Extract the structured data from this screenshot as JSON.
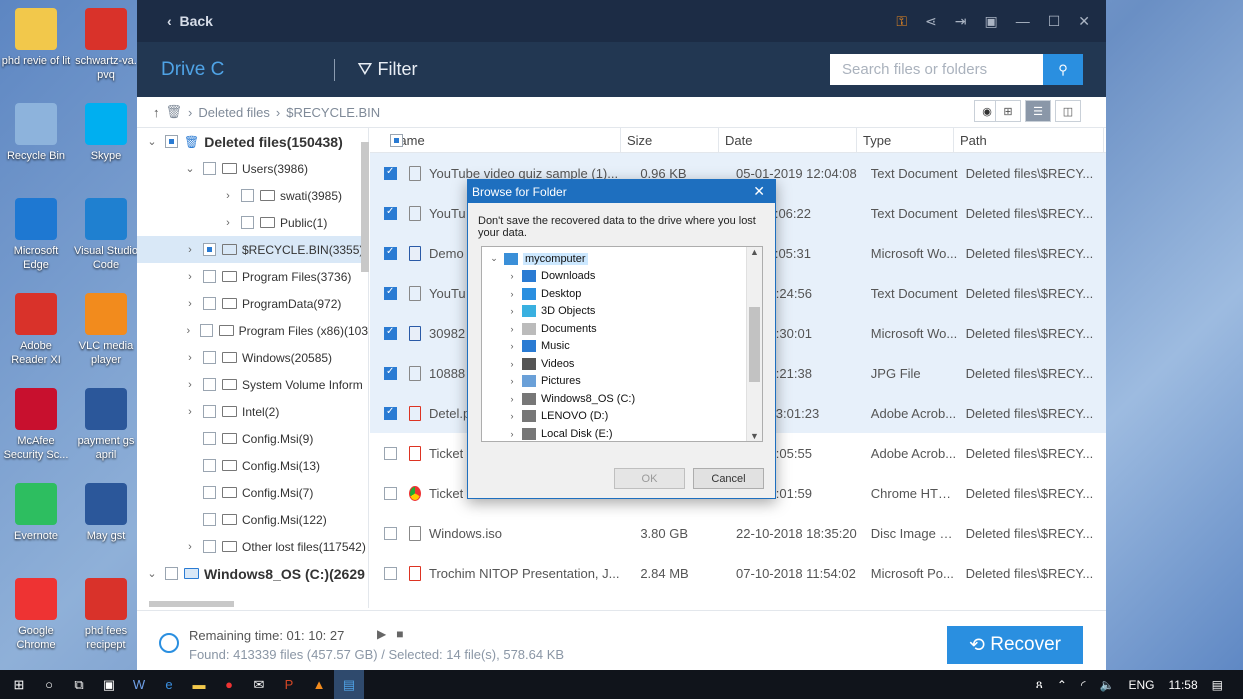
{
  "desktop_icons": [
    {
      "label": "phd revie of lit",
      "icon": "document-icon",
      "color": "#f2c84b"
    },
    {
      "label": "schwartz-va. pvq",
      "icon": "pdf-icon",
      "color": "#d9322a"
    },
    {
      "label": "Recycle Bin",
      "icon": "recycle-bin-icon",
      "color": "#8db3dc"
    },
    {
      "label": "Skype",
      "icon": "skype-icon",
      "color": "#00aff0"
    },
    {
      "label": "Microsoft Edge",
      "icon": "edge-icon",
      "color": "#1e78d2"
    },
    {
      "label": "Visual Studio Code",
      "icon": "vscode-icon",
      "color": "#1f80d0"
    },
    {
      "label": "Adobe Reader XI",
      "icon": "adobe-reader-icon",
      "color": "#d9322a"
    },
    {
      "label": "VLC media player",
      "icon": "vlc-icon",
      "color": "#f28b1d"
    },
    {
      "label": "McAfee Security Sc...",
      "icon": "mcafee-icon",
      "color": "#c8102e"
    },
    {
      "label": "payment gs april",
      "icon": "word-doc-icon",
      "color": "#2b579a"
    },
    {
      "label": "Evernote",
      "icon": "evernote-icon",
      "color": "#2dbe60"
    },
    {
      "label": "May gst",
      "icon": "word-doc-icon",
      "color": "#2b579a"
    },
    {
      "label": "Google Chrome",
      "icon": "chrome-icon",
      "color": "#e33"
    },
    {
      "label": "phd fees recipept",
      "icon": "pdf-icon",
      "color": "#d9322a"
    }
  ],
  "app": {
    "back_label": "Back",
    "drive_label": "Drive C",
    "filter_label": "Filter",
    "search_placeholder": "Search files or folders",
    "breadcrumb": [
      "Deleted files",
      "$RECYCLE.BIN"
    ],
    "tree": [
      {
        "label": "Deleted files(150438)",
        "indent": 0,
        "arrow": "⌄",
        "check": "part",
        "bold": true,
        "icon": "trash"
      },
      {
        "label": "Users(3986)",
        "indent": 1,
        "arrow": "⌄",
        "check": "none"
      },
      {
        "label": "swati(3985)",
        "indent": 2,
        "arrow": "›",
        "check": "none"
      },
      {
        "label": "Public(1)",
        "indent": 2,
        "arrow": "›",
        "check": "none"
      },
      {
        "label": "$RECYCLE.BIN(3355)",
        "indent": 1,
        "arrow": "›",
        "check": "part",
        "selected": true
      },
      {
        "label": "Program Files(3736)",
        "indent": 1,
        "arrow": "›",
        "check": "none"
      },
      {
        "label": "ProgramData(972)",
        "indent": 1,
        "arrow": "›",
        "check": "none"
      },
      {
        "label": "Program Files (x86)(103",
        "indent": 1,
        "arrow": "›",
        "check": "none"
      },
      {
        "label": "Windows(20585)",
        "indent": 1,
        "arrow": "›",
        "check": "none"
      },
      {
        "label": "System Volume Inform",
        "indent": 1,
        "arrow": "›",
        "check": "none"
      },
      {
        "label": "Intel(2)",
        "indent": 1,
        "arrow": "›",
        "check": "none"
      },
      {
        "label": "Config.Msi(9)",
        "indent": 1,
        "arrow": "",
        "check": "none"
      },
      {
        "label": "Config.Msi(13)",
        "indent": 1,
        "arrow": "",
        "check": "none"
      },
      {
        "label": "Config.Msi(7)",
        "indent": 1,
        "arrow": "",
        "check": "none"
      },
      {
        "label": "Config.Msi(122)",
        "indent": 1,
        "arrow": "",
        "check": "none"
      },
      {
        "label": "Other lost files(117542)",
        "indent": 1,
        "arrow": "›",
        "check": "none"
      },
      {
        "label": "Windows8_OS (C:)(2629",
        "indent": 0,
        "arrow": "⌄",
        "check": "none",
        "bold": true,
        "icon": "drive"
      }
    ],
    "columns": {
      "name": "Name",
      "size": "Size",
      "date": "Date",
      "type": "Type",
      "path": "Path"
    },
    "files": [
      {
        "name": "YouTube video quiz sample (1)...",
        "size": "0.96 KB",
        "date": "05-01-2019 12:04:08",
        "type": "Text Document",
        "path": "Deleted files\\$RECY...",
        "checked": true,
        "icon": "txt"
      },
      {
        "name": "YouTu",
        "size": "",
        "date": "019 11:06:22",
        "type": "Text Document",
        "path": "Deleted files\\$RECY...",
        "checked": true,
        "icon": "txt"
      },
      {
        "name": "Demo",
        "size": "",
        "date": "019 11:05:31",
        "type": "Microsoft Wo...",
        "path": "Deleted files\\$RECY...",
        "checked": true,
        "icon": "w"
      },
      {
        "name": "YouTu",
        "size": "",
        "date": "019 18:24:56",
        "type": "Text Document",
        "path": "Deleted files\\$RECY...",
        "checked": true,
        "icon": "txt"
      },
      {
        "name": "30982",
        "size": "",
        "date": "019 17:30:01",
        "type": "Microsoft Wo...",
        "path": "Deleted files\\$RECY...",
        "checked": true,
        "icon": "w"
      },
      {
        "name": "10888",
        "size": "",
        "date": "019 17:21:38",
        "type": "JPG File",
        "path": "Deleted files\\$RECY...",
        "checked": true,
        "icon": "img"
      },
      {
        "name": "Detel.p",
        "size": "",
        "date": "2018 13:01:23",
        "type": "Adobe Acrob...",
        "path": "Deleted files\\$RECY...",
        "checked": true,
        "icon": "pdf"
      },
      {
        "name": "Ticket",
        "size": "",
        "date": "018 12:05:55",
        "type": "Adobe Acrob...",
        "path": "Deleted files\\$RECY...",
        "checked": false,
        "icon": "pdf"
      },
      {
        "name": "Ticket",
        "size": "",
        "date": "018 12:01:59",
        "type": "Chrome HTM...",
        "path": "Deleted files\\$RECY...",
        "checked": false,
        "icon": "c"
      },
      {
        "name": "Windows.iso",
        "size": "3.80 GB",
        "date": "22-10-2018 18:35:20",
        "type": "Disc Image File",
        "path": "Deleted files\\$RECY...",
        "checked": false,
        "icon": "txt"
      },
      {
        "name": "Trochim NITOP Presentation, J...",
        "size": "2.84 MB",
        "date": "07-10-2018 11:54:02",
        "type": "Microsoft Po...",
        "path": "Deleted files\\$RECY...",
        "checked": false,
        "icon": "pdf"
      }
    ],
    "remaining_time": "Remaining time: 01: 10: 27",
    "found": "Found: 413339 files (457.57 GB) / Selected: 14 file(s), 578.64 KB",
    "recover_label": "Recover"
  },
  "dialog": {
    "title": "Browse for Folder",
    "message": "Don't save the recovered data to the drive where you lost your data.",
    "items": [
      {
        "label": "mycomputer",
        "arrow": "⌄",
        "indent": 0,
        "selected": true,
        "color": "#3a8fd8"
      },
      {
        "label": "Downloads",
        "arrow": "›",
        "indent": 1,
        "color": "#2a7bd3"
      },
      {
        "label": "Desktop",
        "arrow": "›",
        "indent": 1,
        "color": "#2a8fe0"
      },
      {
        "label": "3D Objects",
        "arrow": "›",
        "indent": 1,
        "color": "#39b0e0"
      },
      {
        "label": "Documents",
        "arrow": "›",
        "indent": 1,
        "color": "#bbb"
      },
      {
        "label": "Music",
        "arrow": "›",
        "indent": 1,
        "color": "#2a7bd3"
      },
      {
        "label": "Videos",
        "arrow": "›",
        "indent": 1,
        "color": "#555"
      },
      {
        "label": "Pictures",
        "arrow": "›",
        "indent": 1,
        "color": "#6aa0d8"
      },
      {
        "label": "Windows8_OS (C:)",
        "arrow": "›",
        "indent": 1,
        "color": "#777"
      },
      {
        "label": "LENOVO (D:)",
        "arrow": "›",
        "indent": 1,
        "color": "#777"
      },
      {
        "label": "Local Disk (E:)",
        "arrow": "›",
        "indent": 1,
        "color": "#777"
      }
    ],
    "ok_label": "OK",
    "cancel_label": "Cancel"
  },
  "taskbar": {
    "lang": "ENG",
    "time": "11:58"
  }
}
